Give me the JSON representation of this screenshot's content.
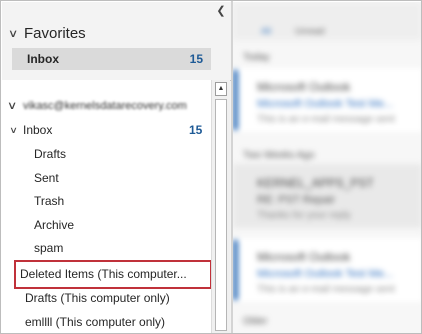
{
  "favorites": {
    "header": "Favorites",
    "inbox_label": "Inbox",
    "inbox_count": "15"
  },
  "account": {
    "name": "vikasc@kernelsdatarecovery.com"
  },
  "tree": {
    "inbox_label": "Inbox",
    "inbox_count": "15",
    "subfolders": [
      "Drafts",
      "Sent",
      "Trash",
      "Archive",
      "spam"
    ],
    "deleted_items": "Deleted Items (This computer...",
    "drafts_local": "Drafts (This computer only)",
    "emllll_local": "emllll (This computer only)"
  },
  "message_list": {
    "tab_all": "All",
    "tab_unread": "Unread",
    "group_today": "Today",
    "group_two_weeks": "Two Weeks Ago",
    "group_older": "Older",
    "msg1_from": "Microsoft Outlook",
    "msg1_subject": "Microsoft Outlook Test Me...",
    "msg1_preview": "This is an e-mail message sent",
    "msg2_from": "KERNEL_APPS_PST",
    "msg2_subject": "RE: PST Repair",
    "msg2_preview": "Thanks for your reply",
    "msg3_from": "Microsoft Outlook",
    "msg3_subject": "Microsoft Outlook Test Me...",
    "msg3_preview": "This is an e-mail message sent"
  },
  "colors": {
    "count_blue": "#1e5a96",
    "highlight_red": "#c0313a",
    "accent_blue": "#2b6cb8"
  }
}
